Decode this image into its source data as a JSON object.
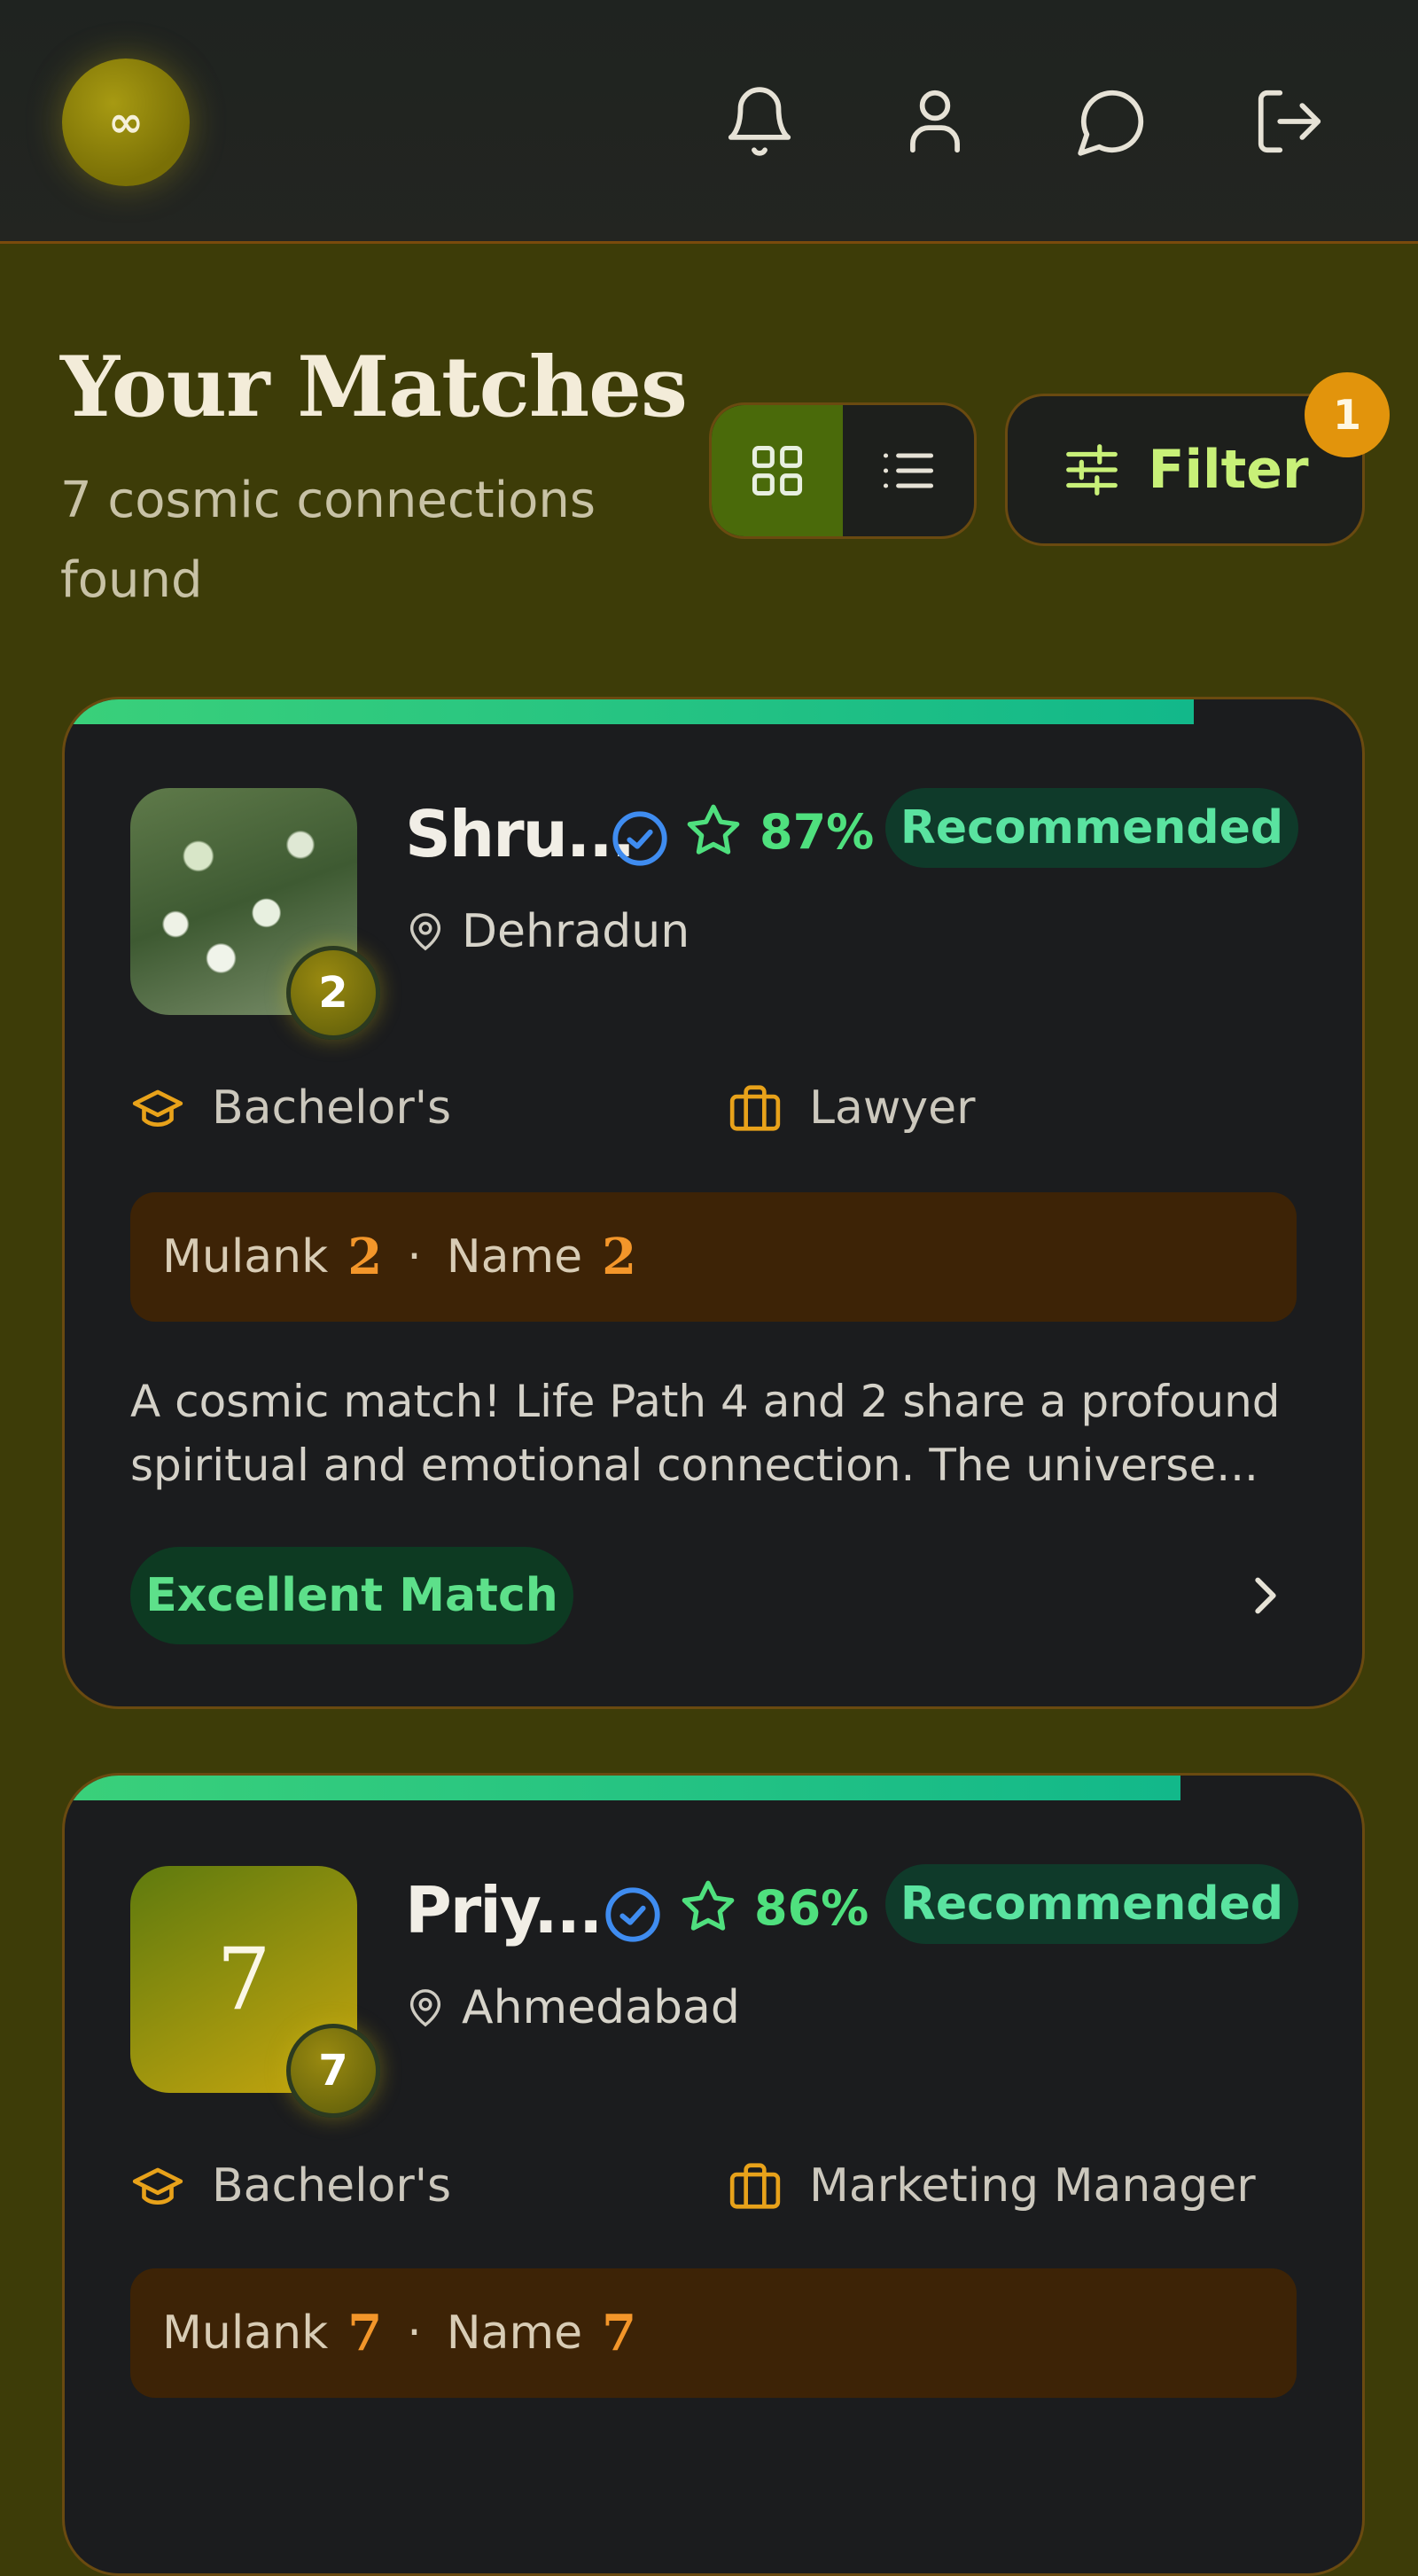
{
  "header": {
    "logo_symbol": "∞",
    "icons": [
      "bell-icon",
      "user-icon",
      "chat-icon",
      "logout-icon"
    ]
  },
  "page": {
    "title": "Your Matches",
    "subtitle": "7 cosmic connections found",
    "filter_label": "Filter",
    "filter_count": "1",
    "active_view": "grid"
  },
  "matches": [
    {
      "name": "Shru...",
      "match_pct": "87%",
      "progress_fraction": 0.87,
      "tag": "Recommended",
      "location": "Dehradun",
      "education": "Bachelor's",
      "profession": "Lawyer",
      "number_badge": "2",
      "mulank_label": "Mulank",
      "mulank_value": "2",
      "name_label": "Name",
      "name_value": "2",
      "description": "A cosmic match! Life Path 4 and 2 share a profound spiritual and emotional connection. The universe...",
      "verdict": "Excellent Match"
    },
    {
      "name": "Priy...",
      "match_pct": "86%",
      "progress_fraction": 0.86,
      "tag": "Recommended",
      "location": "Ahmedabad",
      "education": "Bachelor's",
      "profession": "Marketing Manager",
      "avatar_number": "7",
      "number_badge": "7",
      "mulank_label": "Mulank",
      "mulank_value": "7",
      "name_label": "Name",
      "name_value": "7"
    }
  ],
  "colors": {
    "page_bg": "#3d3c08",
    "card_bg": "#1b1c1e",
    "accent_green": "#4fe07e",
    "accent_orange": "#f3962a",
    "filter_text": "#c8f078"
  }
}
